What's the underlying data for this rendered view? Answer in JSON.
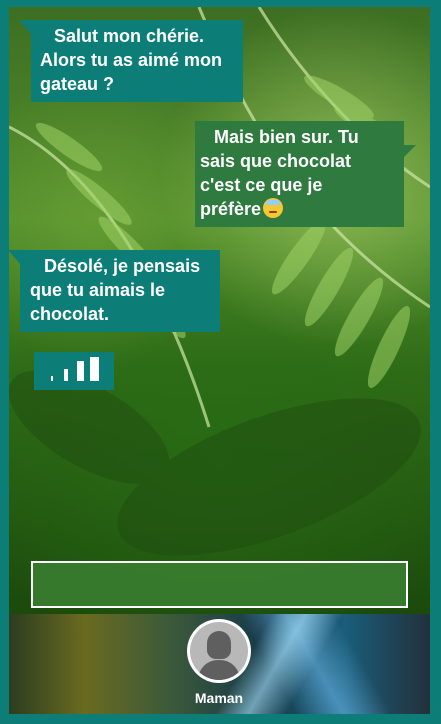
{
  "messages": [
    {
      "side": "left",
      "lines": [
        "Salut mon chérie.",
        "Alors tu as aimé mon",
        "gateau ?"
      ]
    },
    {
      "side": "right",
      "lines": [
        "Mais bien sur. Tu",
        "sais que chocolat",
        "c'est ce que je",
        "préfère"
      ],
      "emoji": "sweat-face-emoji"
    },
    {
      "side": "left",
      "lines": [
        "Désolé, je pensais",
        "que tu aimais le",
        "chocolat."
      ]
    }
  ],
  "typing_indicator": {
    "icon": "typing-bars-icon"
  },
  "composer": {
    "value": "",
    "placeholder": ""
  },
  "contact": {
    "name": "Maman",
    "avatar_icon": "person-avatar-icon"
  },
  "colors": {
    "frame": "#0d7d78",
    "bubble_incoming": "#0d7d78",
    "bubble_outgoing": "#2f7a3f",
    "input_background": "#3a7d30",
    "text": "#ffffff"
  }
}
